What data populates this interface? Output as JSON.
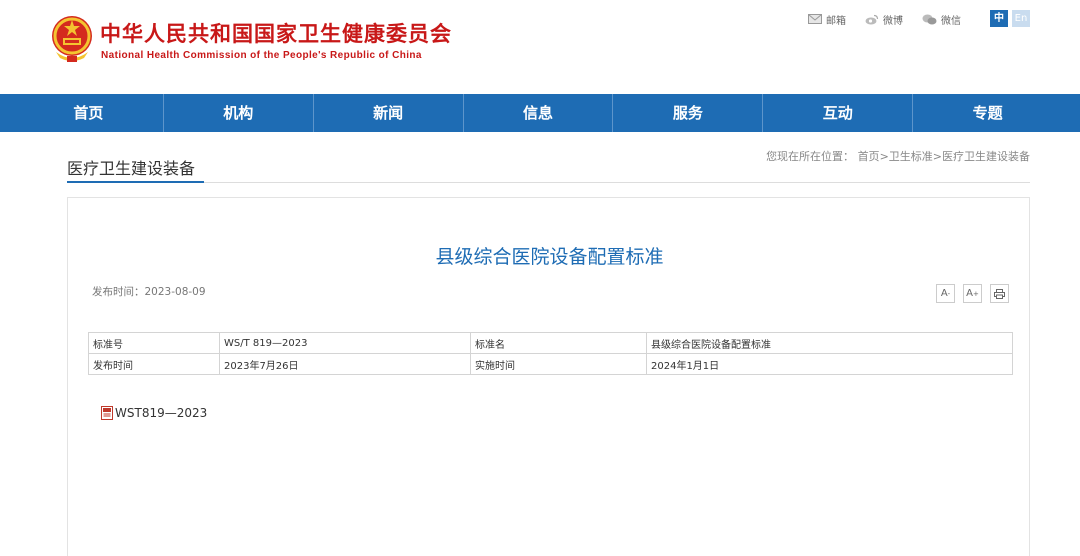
{
  "header": {
    "title": "中华人民共和国国家卫生健康委员会",
    "subtitle": "National Health Commission of the People's Republic of China",
    "emblem_icon": "national-emblem-icon",
    "brand_color": "#c81818",
    "top_links": [
      {
        "label": "邮箱",
        "icon": "mail-icon"
      },
      {
        "label": "微博",
        "icon": "weibo-icon"
      },
      {
        "label": "微信",
        "icon": "wechat-icon"
      }
    ],
    "lang_zh": "中",
    "lang_en": "En"
  },
  "nav": {
    "color": "#1e6cb4",
    "items": [
      {
        "label": "首页"
      },
      {
        "label": "机构"
      },
      {
        "label": "新闻"
      },
      {
        "label": "信息"
      },
      {
        "label": "服务"
      },
      {
        "label": "互动"
      },
      {
        "label": "专题"
      }
    ]
  },
  "section": {
    "title": "医疗卫生建设装备",
    "breadcrumb_prefix": "您现在所在位置：",
    "breadcrumb": [
      "首页",
      "卫生标准",
      "医疗卫生建设装备"
    ],
    "separator": ">"
  },
  "article": {
    "title": "县级综合医院设备配置标准",
    "publish_label": "发布时间：",
    "publish_date": "2023-08-09",
    "tools": {
      "font_smaller": "A",
      "font_larger": "A",
      "print_icon": "print-icon"
    },
    "table": {
      "rows": [
        [
          "标准号",
          "WS/T 819—2023",
          "标准名",
          "县级综合医院设备配置标准"
        ],
        [
          "发布时间",
          "2023年7月26日",
          "实施时间",
          "2024年1月1日"
        ]
      ]
    },
    "attachment": {
      "label": "WST819—2023",
      "icon": "pdf-icon"
    }
  }
}
